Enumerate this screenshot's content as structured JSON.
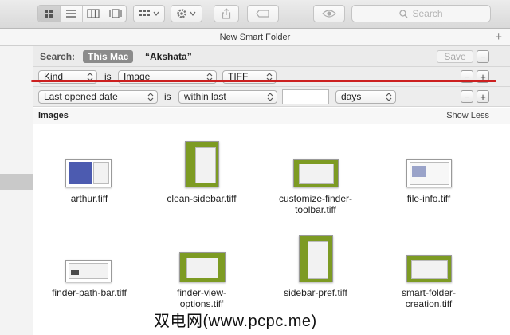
{
  "toolbar": {
    "view_buttons": [
      "icon-view-icon",
      "list-view-icon",
      "column-view-icon",
      "coverflow-view-icon"
    ],
    "search_placeholder": "Search"
  },
  "window": {
    "title": "New Smart Folder",
    "add_symbol": "+"
  },
  "search_bar": {
    "label": "Search:",
    "scope_active": "This Mac",
    "scope_other": "“Akshata”",
    "save_label": "Save",
    "remove_symbol": "−"
  },
  "criteria": [
    {
      "attribute": "Kind",
      "operator": "is",
      "value": "Image",
      "subvalue": "TIFF"
    },
    {
      "attribute": "Last opened date",
      "operator": "is",
      "value": "within last",
      "input_value": "",
      "unit": "days"
    }
  ],
  "row_buttons": {
    "remove": "−",
    "add": "+"
  },
  "results": {
    "section_title": "Images",
    "toggle_label": "Show Less",
    "files": [
      {
        "name": "arthur.tiff"
      },
      {
        "name": "clean-sidebar.tiff"
      },
      {
        "name": "customize-finder-toolbar.tiff"
      },
      {
        "name": "file-info.tiff"
      },
      {
        "name": "finder-path-bar.tiff"
      },
      {
        "name": "finder-view-options.tiff"
      },
      {
        "name": "sidebar-pref.tiff"
      },
      {
        "name": "smart-folder-creation.tiff"
      }
    ]
  },
  "watermark": "双电网(www.pcpc.me)",
  "colors": {
    "annotation_red": "#cc1f1f",
    "scope_active_bg": "#8b8b8b",
    "thumb_green": "#7d9b23"
  }
}
